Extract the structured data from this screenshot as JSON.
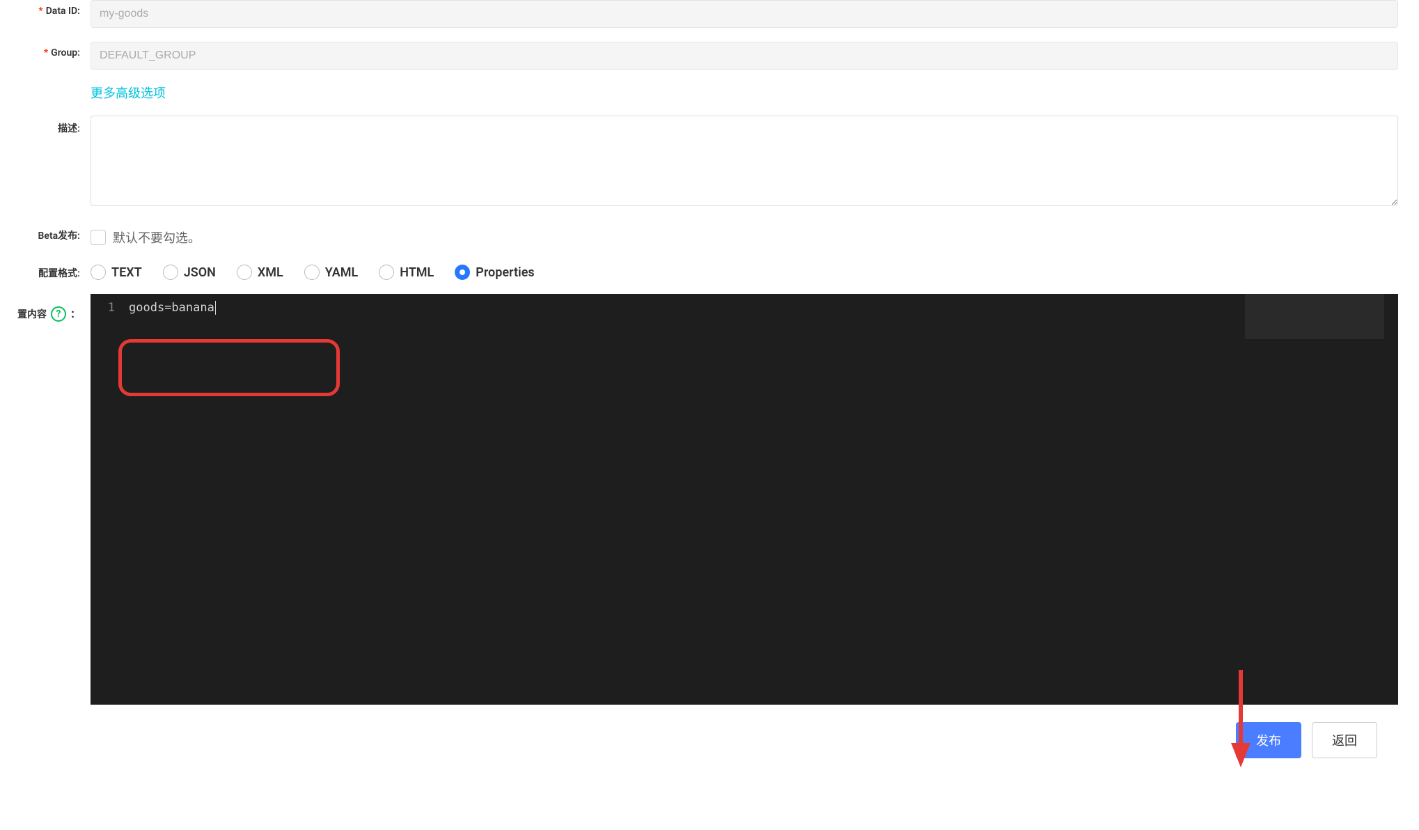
{
  "form": {
    "dataId": {
      "label": "Data ID:",
      "value": "my-goods"
    },
    "group": {
      "label": "Group:",
      "value": "DEFAULT_GROUP"
    },
    "advancedLink": "更多高级选项",
    "description": {
      "label": "描述:",
      "value": ""
    },
    "beta": {
      "label": "Beta发布:",
      "checkboxLabel": "默认不要勾选。"
    },
    "format": {
      "label": "配置格式:",
      "options": [
        {
          "value": "TEXT",
          "selected": false
        },
        {
          "value": "JSON",
          "selected": false
        },
        {
          "value": "XML",
          "selected": false
        },
        {
          "value": "YAML",
          "selected": false
        },
        {
          "value": "HTML",
          "selected": false
        },
        {
          "value": "Properties",
          "selected": true
        }
      ]
    },
    "content": {
      "label": "置内容",
      "colon": "：",
      "lineNumber": "1",
      "code": "goods=banana"
    }
  },
  "buttons": {
    "publish": "发布",
    "back": "返回"
  }
}
